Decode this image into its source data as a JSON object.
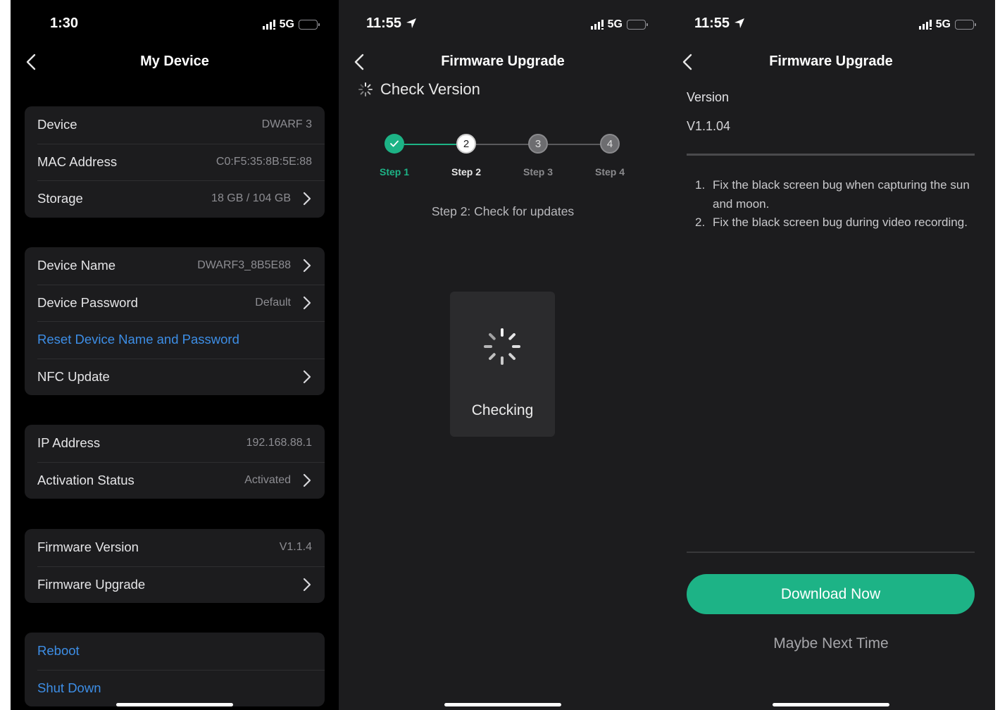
{
  "colors": {
    "accent_green": "#1db386",
    "link_blue": "#3d8ee6",
    "battery_yellow": "#ffd60a"
  },
  "screen1": {
    "status": {
      "time": "1:30",
      "network": "5G"
    },
    "nav": {
      "title": "My Device"
    },
    "groups": [
      {
        "rows": [
          {
            "label": "Device",
            "value": "DWARF 3",
            "chevron": false
          },
          {
            "label": "MAC Address",
            "value": "C0:F5:35:8B:5E:88",
            "chevron": false
          },
          {
            "label": "Storage",
            "value": "18 GB / 104 GB",
            "chevron": true
          }
        ]
      },
      {
        "rows": [
          {
            "label": "Device Name",
            "value": "DWARF3_8B5E88",
            "chevron": true
          },
          {
            "label": "Device Password",
            "value": "Default",
            "chevron": true
          },
          {
            "link": "Reset Device Name and Password"
          },
          {
            "label": "NFC Update",
            "value": "",
            "chevron": true
          }
        ]
      },
      {
        "rows": [
          {
            "label": "IP Address",
            "value": "192.168.88.1",
            "chevron": false
          },
          {
            "label": "Activation Status",
            "value": "Activated",
            "chevron": true
          }
        ]
      },
      {
        "rows": [
          {
            "label": "Firmware Version",
            "value": "V1.1.4",
            "chevron": false
          },
          {
            "label": "Firmware Upgrade",
            "value": "",
            "chevron": true
          }
        ]
      },
      {
        "rows": [
          {
            "link": "Reboot"
          },
          {
            "link": "Shut Down"
          }
        ]
      }
    ]
  },
  "screen2": {
    "status": {
      "time": "11:55",
      "network": "5G"
    },
    "nav": {
      "title": "Firmware Upgrade"
    },
    "section_title": "Check Version",
    "steps": [
      {
        "label": "Step 1",
        "number": "",
        "state": "done"
      },
      {
        "label": "Step 2",
        "number": "2",
        "state": "active"
      },
      {
        "label": "Step 3",
        "number": "3",
        "state": "pending"
      },
      {
        "label": "Step 4",
        "number": "4",
        "state": "pending"
      }
    ],
    "step_description": "Step 2: Check for updates",
    "loading_text": "Checking"
  },
  "screen3": {
    "status": {
      "time": "11:55",
      "network": "5G"
    },
    "nav": {
      "title": "Firmware Upgrade"
    },
    "version_label": "Version",
    "version_value": "V1.1.04",
    "release_notes": [
      {
        "num": "1.",
        "text": "Fix the black screen bug when capturing the sun and moon."
      },
      {
        "num": "2.",
        "text": "Fix the black screen bug during video recording."
      }
    ],
    "download_button": "Download Now",
    "maybe_later": "Maybe Next Time"
  }
}
